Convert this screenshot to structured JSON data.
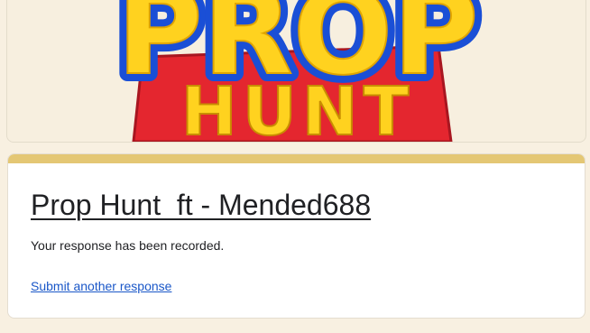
{
  "banner": {
    "logo_line1": "PROP",
    "logo_line2": "HUNT",
    "colors": {
      "background": "#f7efdf",
      "logo_yellow": "#ffd21f",
      "logo_blue": "#1a4fd6",
      "logo_red": "#e4262f"
    }
  },
  "form": {
    "title": "Prop Hunt  ft - Mended688",
    "confirmation": "Your response has been recorded.",
    "submit_another_label": "Submit another response",
    "accent_color": "#e4c774"
  }
}
